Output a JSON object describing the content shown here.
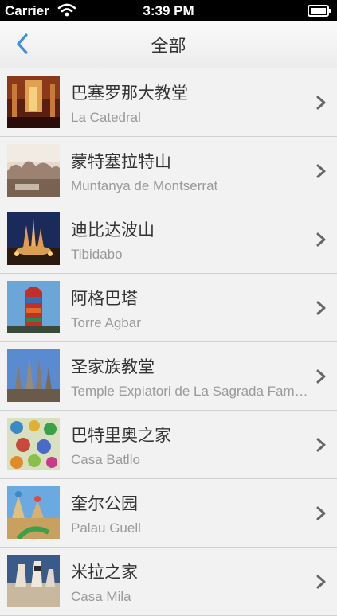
{
  "status_bar": {
    "carrier": "Carrier",
    "time": "3:39 PM",
    "wifi_icon": "wifi-icon",
    "battery_icon": "battery-icon"
  },
  "nav": {
    "title": "全部",
    "back_icon": "chevron-left-icon"
  },
  "items": [
    {
      "title": "巴塞罗那大教堂",
      "subtitle": "La Catedral"
    },
    {
      "title": "蒙特塞拉特山",
      "subtitle": "Muntanya de Montserrat"
    },
    {
      "title": "迪比达波山",
      "subtitle": "Tibidabo"
    },
    {
      "title": "阿格巴塔",
      "subtitle": "Torre Agbar"
    },
    {
      "title": "圣家族教堂",
      "subtitle": "Temple Expiatori de La Sagrada Família"
    },
    {
      "title": "巴特里奥之家",
      "subtitle": "Casa Batllo"
    },
    {
      "title": "奎尔公园",
      "subtitle": "Palau Guell"
    },
    {
      "title": "米拉之家",
      "subtitle": "Casa Mila"
    }
  ]
}
